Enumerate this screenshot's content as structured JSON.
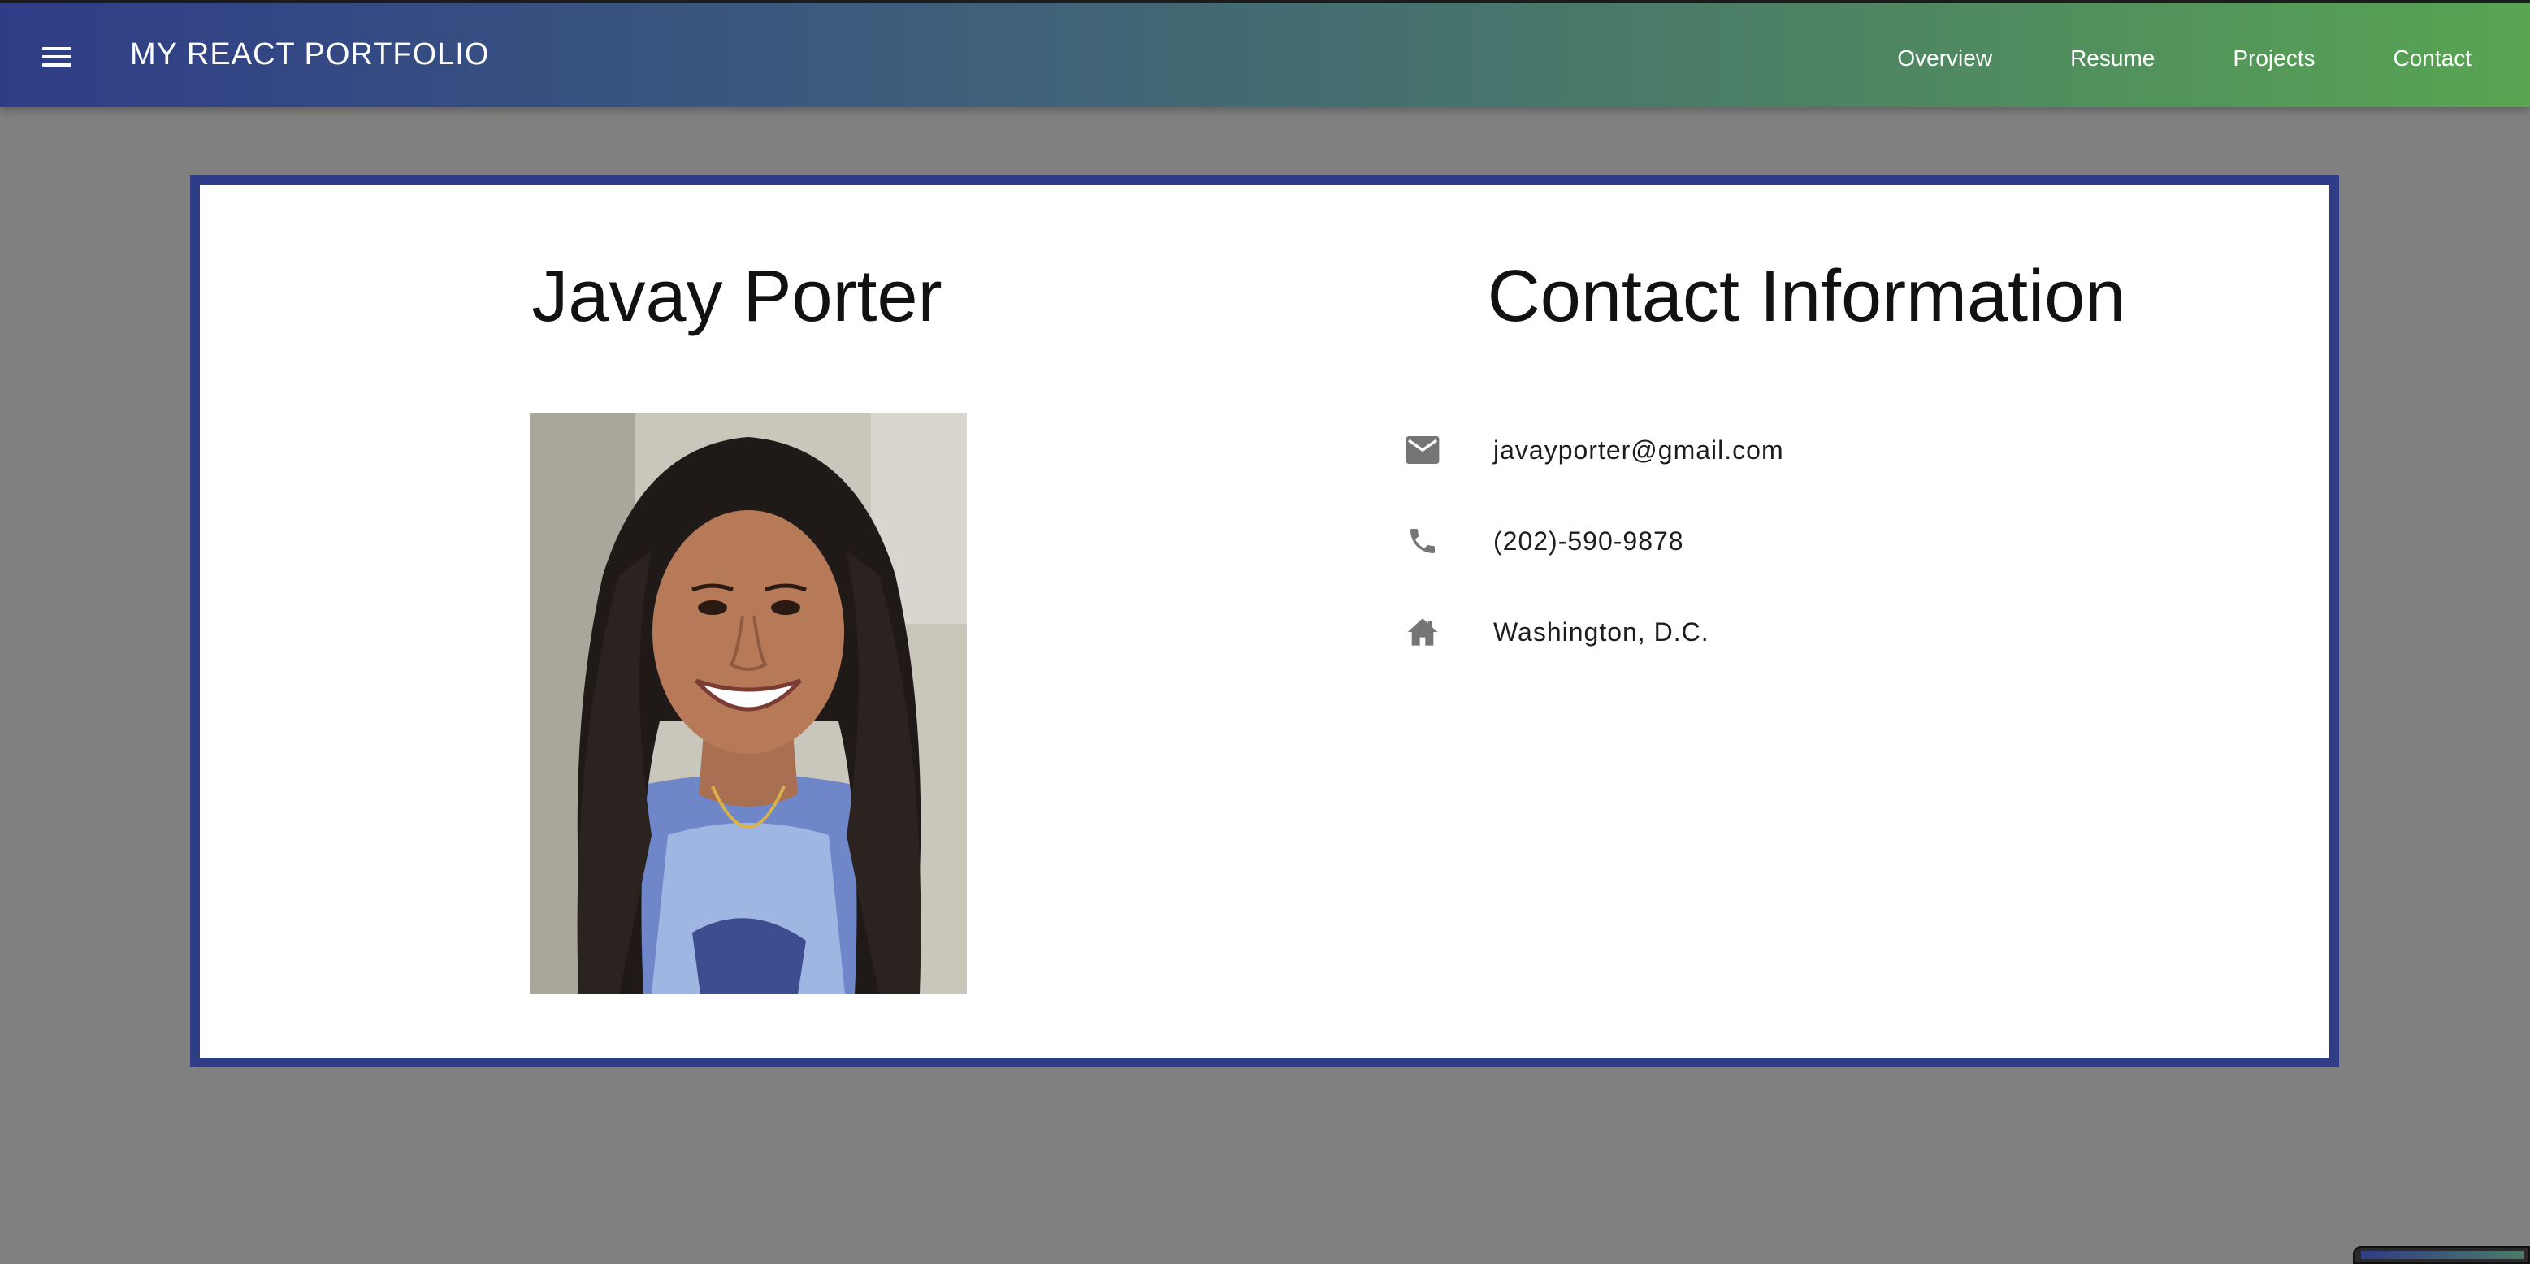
{
  "appbar": {
    "title": "MY REACT PORTFOLIO",
    "menu_icon": "menu-icon",
    "nav": [
      "Overview",
      "Resume",
      "Projects",
      "Contact"
    ],
    "gradient_start": "#2f3d87",
    "gradient_end": "#58a552"
  },
  "profile": {
    "name": "Javay Porter",
    "photo_alt": "portrait-photo"
  },
  "contact": {
    "title": "Contact Information",
    "items": [
      {
        "icon": "email-icon",
        "text": "javayporter@gmail.com"
      },
      {
        "icon": "phone-icon",
        "text": "(202)-590-9878"
      },
      {
        "icon": "home-icon",
        "text": "Washington, D.C."
      }
    ]
  },
  "colors": {
    "background": "#808080",
    "card_border": "#2f3d87",
    "icon": "#757575"
  }
}
